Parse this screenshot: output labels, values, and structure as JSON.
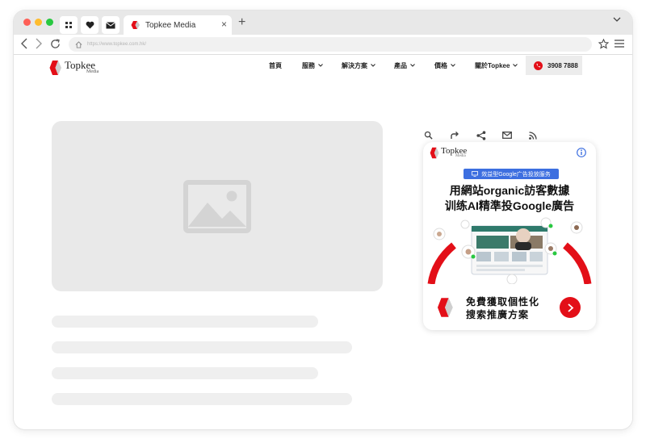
{
  "browser": {
    "tab_title": "Topkee Media",
    "tab_close": "×",
    "new_tab": "+",
    "url": "https://www.topkee.com.hk/"
  },
  "site": {
    "logo_name": "Topkee",
    "logo_sub": "Media",
    "nav": [
      {
        "label": "首頁",
        "dropdown": false
      },
      {
        "label": "服務",
        "dropdown": true
      },
      {
        "label": "解決方案",
        "dropdown": true
      },
      {
        "label": "產品",
        "dropdown": true
      },
      {
        "label": "價格",
        "dropdown": true
      },
      {
        "label": "關於Topkee",
        "dropdown": true
      }
    ],
    "phone": "3908 7888"
  },
  "ad": {
    "logo_name": "Topkee",
    "logo_sub": "Media",
    "badge": "效益型Google广告投放服务",
    "headline_1": "用網站organic訪客數據",
    "headline_2": "训练AI精準投Google廣告",
    "cta_1": "免費獲取個性化",
    "cta_2": "搜索推廣方案"
  },
  "colors": {
    "brand_red": "#e30f18",
    "badge_blue": "#3d6fe0",
    "placeholder_gray": "#e9e9e9"
  },
  "icons": [
    "apps-grid-icon",
    "heart-icon",
    "mail-icon",
    "back-icon",
    "forward-icon",
    "reload-icon",
    "home-icon",
    "star-icon",
    "menu-icon",
    "chevron-down-icon",
    "phone-icon",
    "image-placeholder-icon",
    "search-icon",
    "redo-icon",
    "share-icon",
    "email-icon",
    "rss-icon",
    "info-icon",
    "arrow-right-icon"
  ]
}
